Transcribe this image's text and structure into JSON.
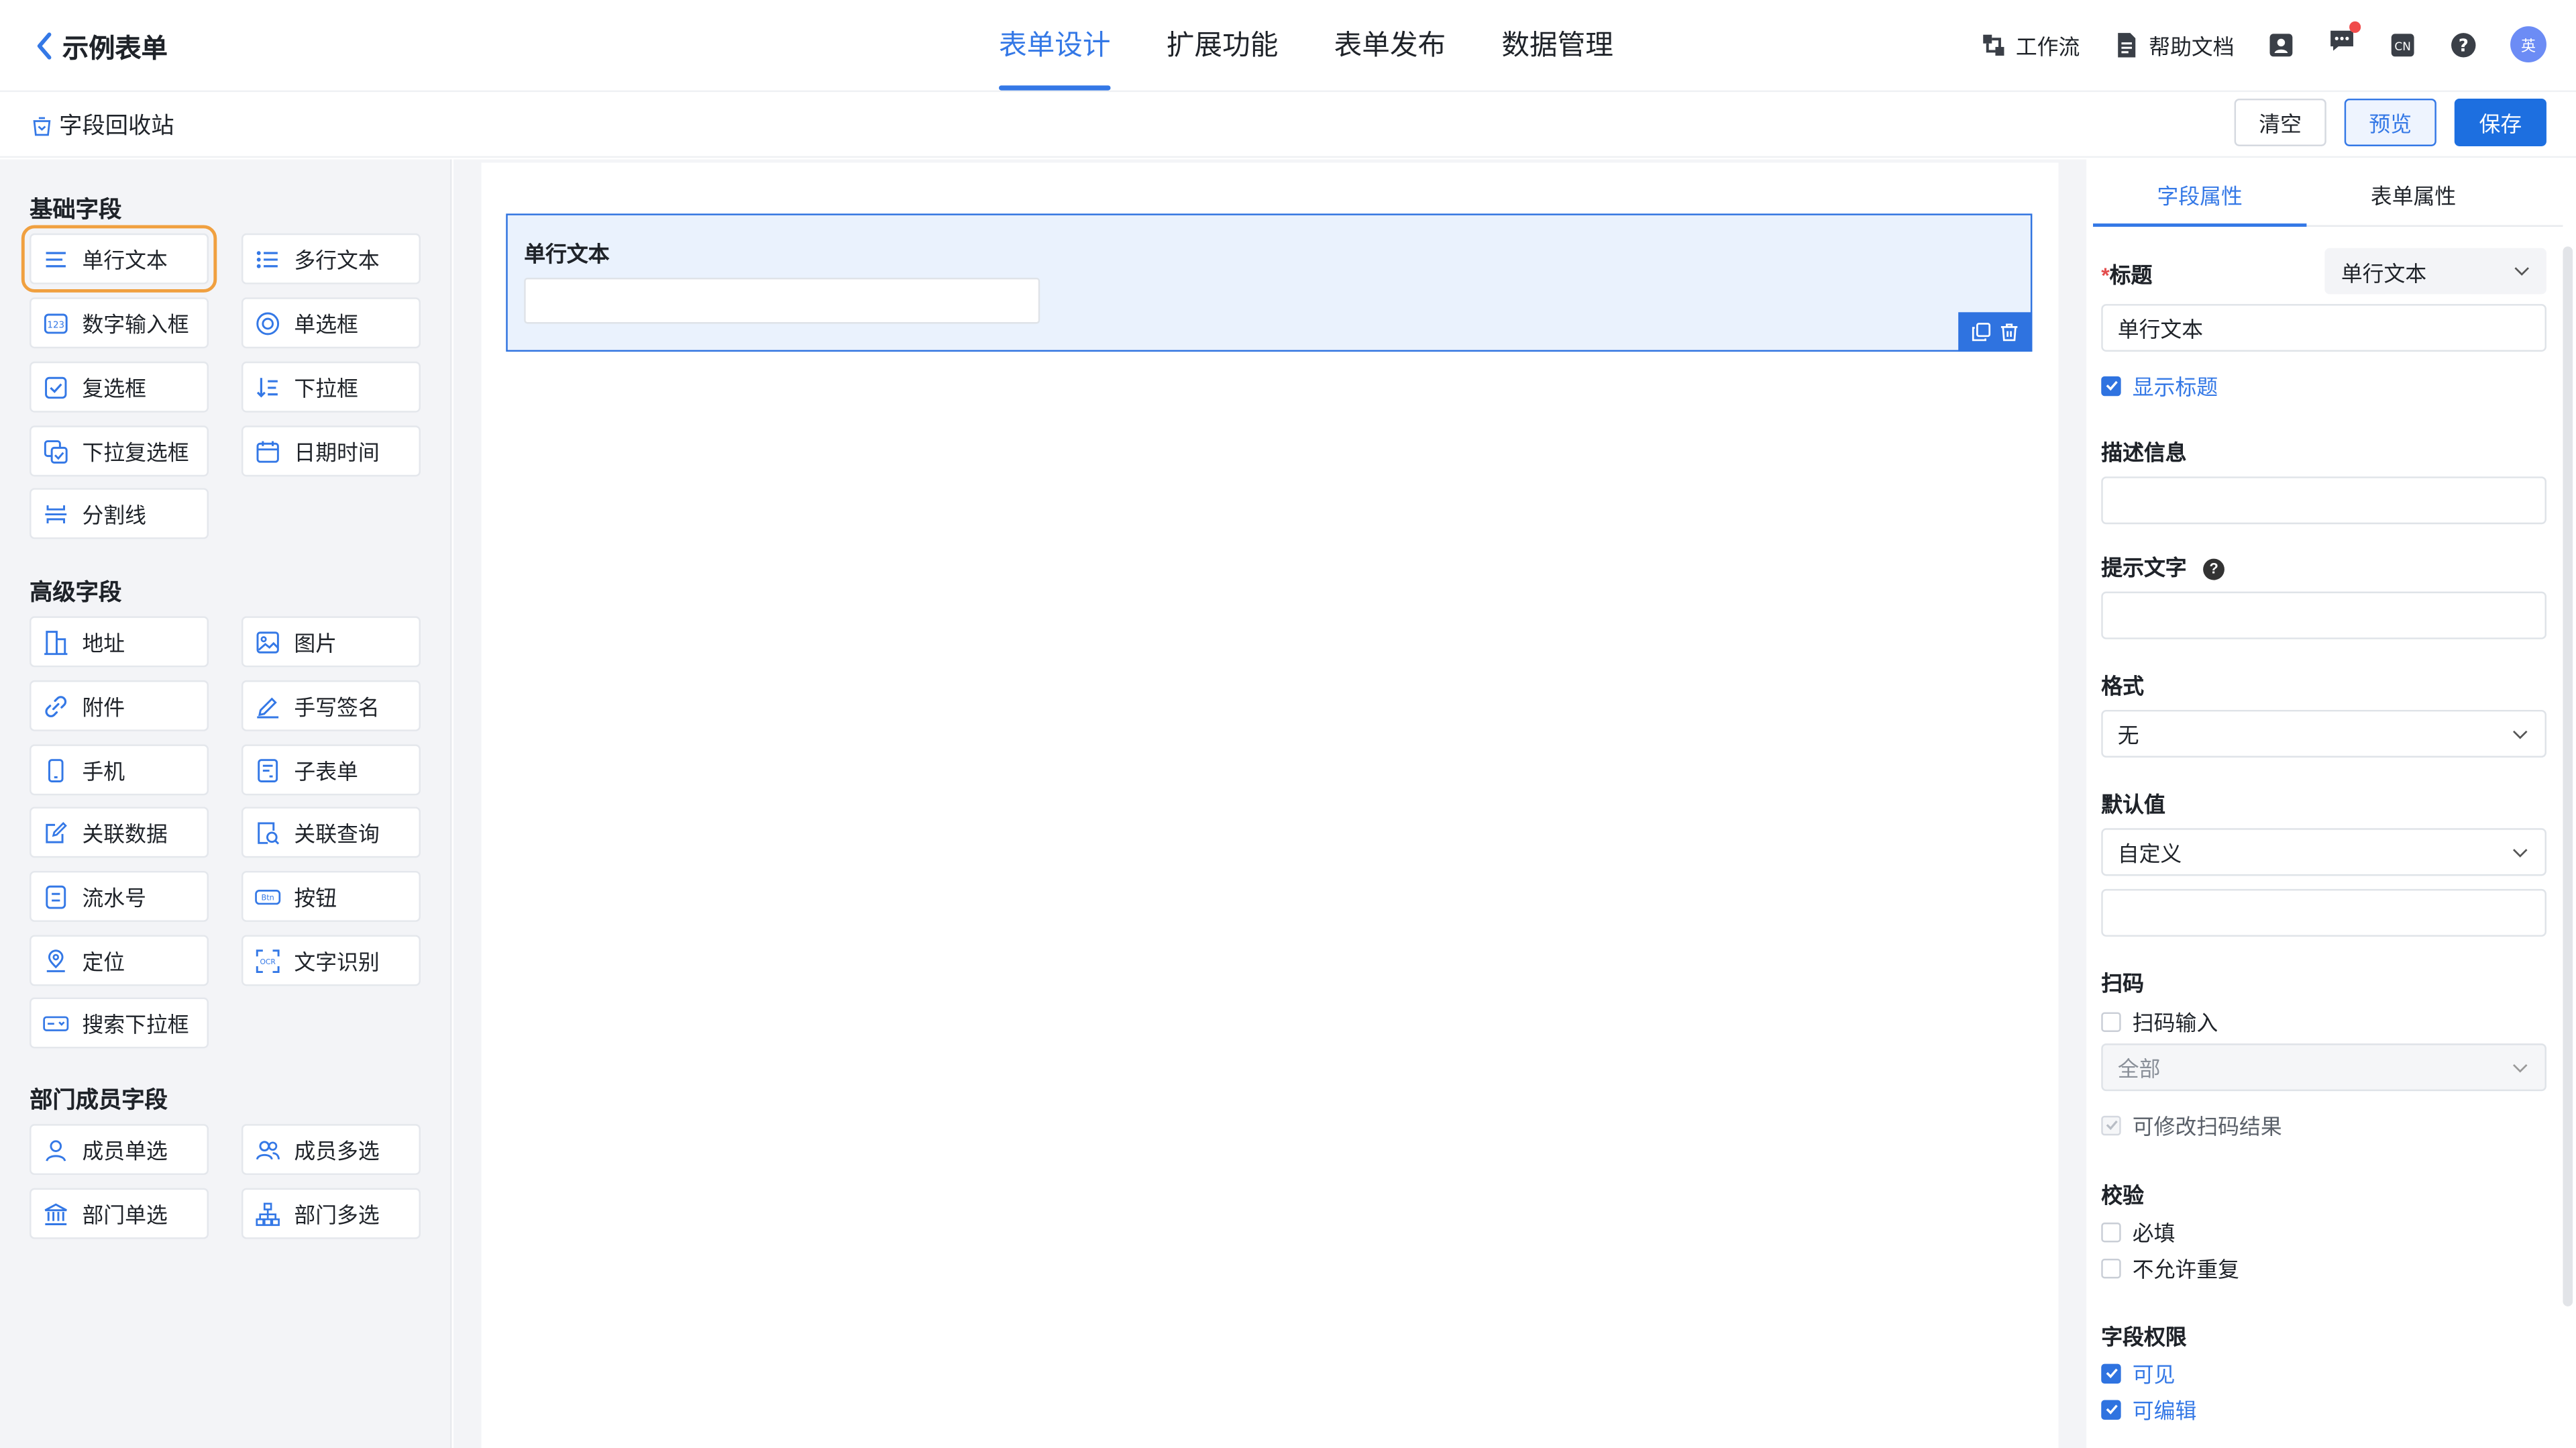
{
  "header": {
    "back_title": "示例表单",
    "tabs": [
      {
        "label": "表单设计",
        "active": true
      },
      {
        "label": "扩展功能",
        "active": false
      },
      {
        "label": "表单发布",
        "active": false
      },
      {
        "label": "数据管理",
        "active": false
      }
    ],
    "workflow_label": "工作流",
    "help_label": "帮助文档",
    "lang_label": "CN",
    "avatar_text": "英",
    "accent_color": "#3478e6"
  },
  "subbar": {
    "recycle_label": "字段回收站",
    "clear_label": "清空",
    "preview_label": "预览",
    "save_label": "保存"
  },
  "left": {
    "basic_title": "基础字段",
    "basic": [
      "单行文本",
      "多行文本",
      "数字输入框",
      "单选框",
      "复选框",
      "下拉框",
      "下拉复选框",
      "日期时间",
      "分割线"
    ],
    "advanced_title": "高级字段",
    "advanced": [
      "地址",
      "图片",
      "附件",
      "手写签名",
      "手机",
      "子表单",
      "关联数据",
      "关联查询",
      "流水号",
      "按钮",
      "定位",
      "文字识别",
      "搜索下拉框"
    ],
    "member_title": "部门成员字段",
    "member": [
      "成员单选",
      "成员多选",
      "部门单选",
      "部门多选"
    ]
  },
  "canvas": {
    "field_label": "单行文本",
    "field_value": ""
  },
  "props": {
    "tab_field": "字段属性",
    "tab_form": "表单属性",
    "title_label": "标题",
    "title_type": "单行文本",
    "title_value": "单行文本",
    "show_title": "显示标题",
    "desc_label": "描述信息",
    "desc_value": "",
    "hint_label": "提示文字",
    "hint_value": "",
    "format_label": "格式",
    "format_value": "无",
    "default_label": "默认值",
    "default_mode": "自定义",
    "default_value": "",
    "scan_label": "扫码",
    "scan_input": "扫码输入",
    "scan_scope": "全部",
    "scan_editable": "可修改扫码结果",
    "validate_label": "校验",
    "required": "必填",
    "no_duplicate": "不允许重复",
    "perm_label": "字段权限",
    "visible": "可见",
    "editable": "可编辑"
  }
}
